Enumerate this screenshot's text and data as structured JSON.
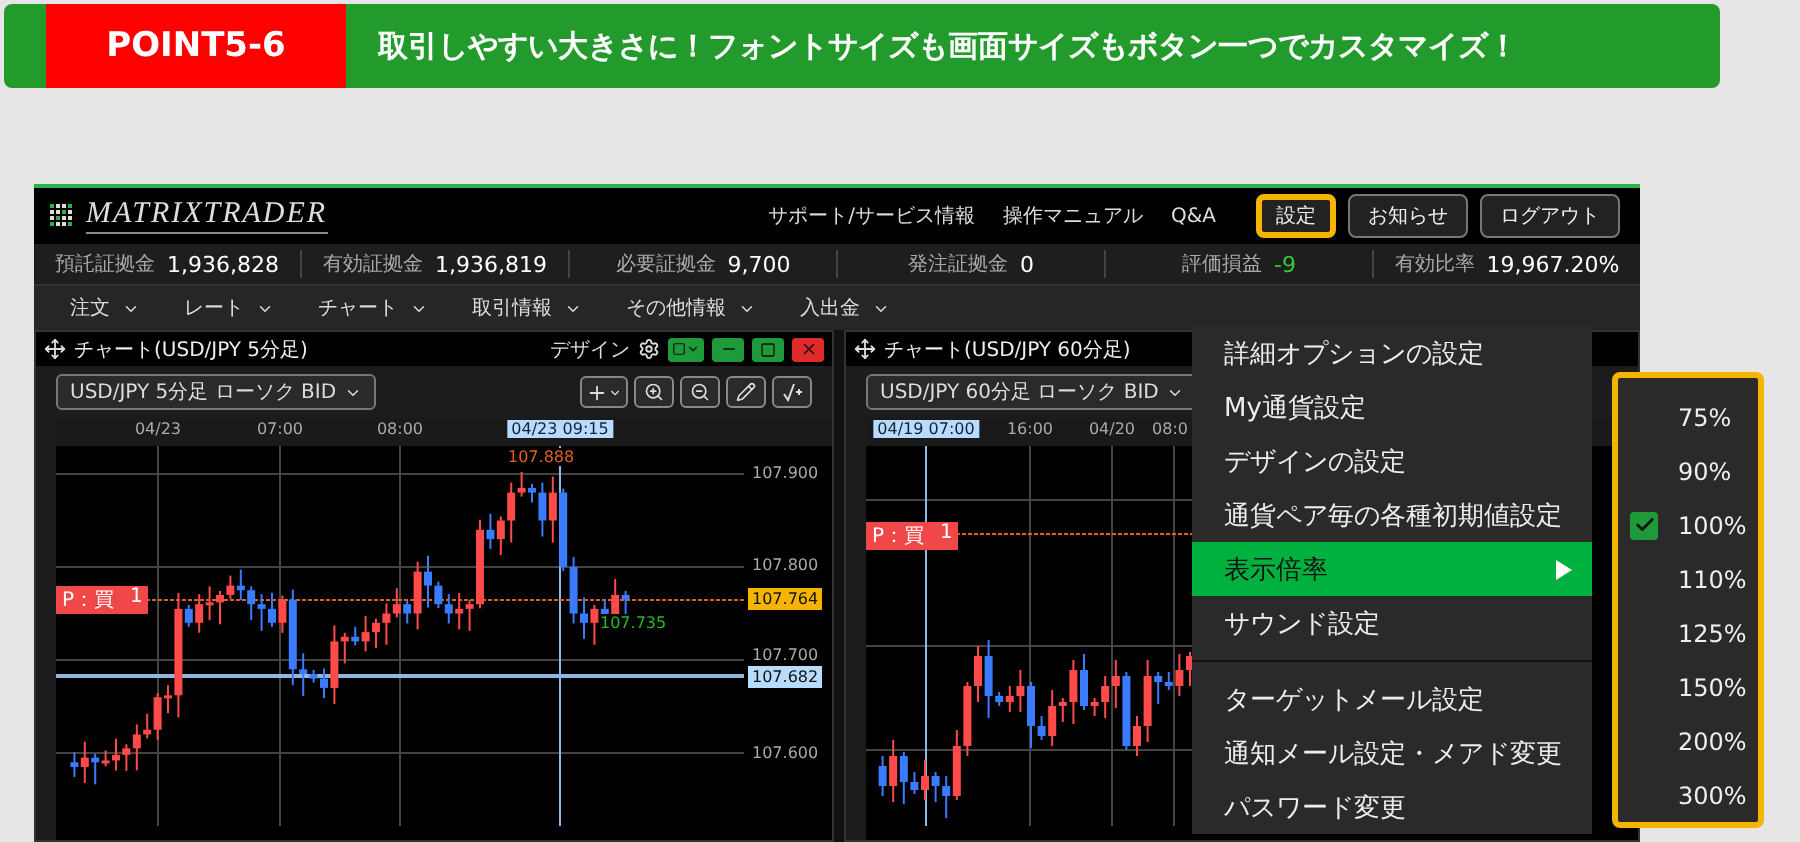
{
  "banner": {
    "badge": "POINT5-6",
    "headline": "取引しやすい大きさに！フォントサイズも画面サイズもボタン一つでカスタマイズ！"
  },
  "app": {
    "logo": "MATRIXTRADER",
    "header_links": [
      {
        "label": "サポート/サービス情報"
      },
      {
        "label": "操作マニュアル"
      },
      {
        "label": "Q&A"
      }
    ],
    "header_buttons": [
      {
        "label": "設定",
        "highlighted": true
      },
      {
        "label": "お知らせ",
        "highlighted": false
      },
      {
        "label": "ログアウト",
        "highlighted": false
      }
    ],
    "account_stats": [
      {
        "label": "預託証拠金",
        "value": "1,936,828",
        "color": "#ffffff"
      },
      {
        "label": "有効証拠金",
        "value": "1,936,819",
        "color": "#ffffff"
      },
      {
        "label": "必要証拠金",
        "value": "9,700",
        "color": "#ffffff"
      },
      {
        "label": "発注証拠金",
        "value": "0",
        "color": "#ffffff"
      },
      {
        "label": "評価損益",
        "value": "-9",
        "color": "#33cc33"
      },
      {
        "label": "有効比率",
        "value": "19,967.20%",
        "color": "#ffffff"
      }
    ],
    "menu": [
      {
        "label": "注文"
      },
      {
        "label": "レート"
      },
      {
        "label": "チャート"
      },
      {
        "label": "取引情報"
      },
      {
        "label": "その他情報"
      },
      {
        "label": "入出金"
      }
    ],
    "charts": [
      {
        "title": "チャート(USD/JPY 5分足)",
        "design_label": "デザイン",
        "selector": "USD/JPY 5分足 ローソク BID",
        "time_labels": [
          {
            "label": "04/23",
            "selected": false
          },
          {
            "label": "07:00",
            "selected": false
          },
          {
            "label": "08:00",
            "selected": false
          },
          {
            "label": "04/23 09:15",
            "selected": true
          }
        ],
        "price_labels": [
          {
            "label": "107.900",
            "kind": "tick"
          },
          {
            "label": "107.800",
            "kind": "tick"
          },
          {
            "label": "107.764",
            "kind": "last"
          },
          {
            "label": "107.700",
            "kind": "tick"
          },
          {
            "label": "107.682",
            "kind": "line"
          },
          {
            "label": "107.600",
            "kind": "tick"
          }
        ],
        "position_tag": {
          "side": "P：買",
          "quantity": "1"
        },
        "annotations": [
          {
            "label": "107.888",
            "kind": "high"
          },
          {
            "label": "107.735",
            "kind": "low"
          }
        ]
      },
      {
        "title": "チャート(USD/JPY 60分足)",
        "selector": "USD/JPY 60分足 ローソク BID",
        "time_labels": [
          {
            "label": "04/19 07:00",
            "selected": true
          },
          {
            "label": "16:00",
            "selected": false
          },
          {
            "label": "04/20",
            "selected": false
          },
          {
            "label": "08:0",
            "selected": false
          }
        ],
        "position_tag": {
          "side": "P：買",
          "quantity": "1"
        }
      }
    ],
    "settings_menu": [
      {
        "kind": "item",
        "label": "詳細オプションの設定",
        "selected": false,
        "has_submenu": false
      },
      {
        "kind": "item",
        "label": "My通貨設定",
        "selected": false,
        "has_submenu": false
      },
      {
        "kind": "item",
        "label": "デザインの設定",
        "selected": false,
        "has_submenu": false
      },
      {
        "kind": "item",
        "label": "通貨ペア毎の各種初期値設定",
        "selected": false,
        "has_submenu": false
      },
      {
        "kind": "item",
        "label": "表示倍率",
        "selected": true,
        "has_submenu": true
      },
      {
        "kind": "item",
        "label": "サウンド設定",
        "selected": false,
        "has_submenu": false
      },
      {
        "kind": "divider"
      },
      {
        "kind": "item",
        "label": "ターゲットメール設定",
        "selected": false,
        "has_submenu": false
      },
      {
        "kind": "item",
        "label": "通知メール設定・メアド変更",
        "selected": false,
        "has_submenu": false
      },
      {
        "kind": "item",
        "label": "パスワード変更",
        "selected": false,
        "has_submenu": false
      }
    ],
    "zoom_submenu": {
      "highlighted": true,
      "options": [
        {
          "label": "75%",
          "checked": false
        },
        {
          "label": "90%",
          "checked": false
        },
        {
          "label": "100%",
          "checked": true
        },
        {
          "label": "110%",
          "checked": false
        },
        {
          "label": "125%",
          "checked": false
        },
        {
          "label": "150%",
          "checked": false
        },
        {
          "label": "200%",
          "checked": false
        },
        {
          "label": "300%",
          "checked": false
        }
      ]
    }
  }
}
